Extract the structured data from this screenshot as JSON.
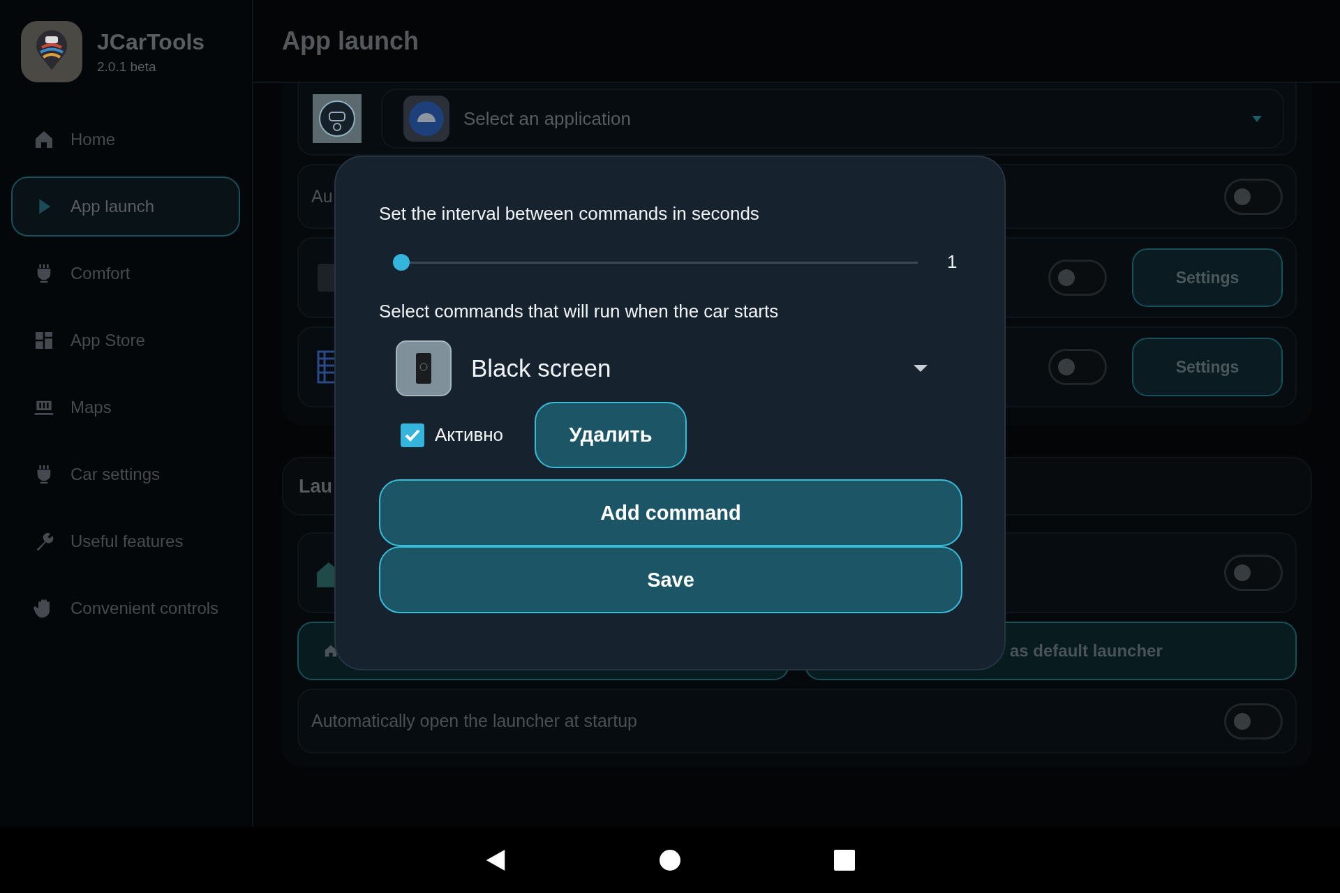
{
  "app": {
    "name": "JCarTools",
    "version": "2.0.1 beta"
  },
  "sidebar": {
    "items": [
      {
        "label": "Home",
        "selected": false
      },
      {
        "label": "App launch",
        "selected": true
      },
      {
        "label": "Comfort",
        "selected": false
      },
      {
        "label": "App Store",
        "selected": false
      },
      {
        "label": "Maps",
        "selected": false
      },
      {
        "label": "Car settings",
        "selected": false
      },
      {
        "label": "Useful features",
        "selected": false
      },
      {
        "label": "Convenient controls",
        "selected": false
      }
    ]
  },
  "header": {
    "title": "App launch"
  },
  "startup_section": {
    "app_select": {
      "placeholder": "Select an application"
    },
    "rows": [
      {
        "kind": "toggle",
        "label": "Au",
        "on": false
      },
      {
        "kind": "settings",
        "on": false,
        "button": "Settings"
      },
      {
        "kind": "settings",
        "on": false,
        "button": "Settings"
      }
    ]
  },
  "launcher_section": {
    "title": "Lau",
    "rows": [
      {
        "kind": "toggle",
        "on": false
      }
    ],
    "buttons": [
      {
        "kind": "icon"
      },
      {
        "kind": "text",
        "label": "as default launcher"
      }
    ],
    "auto_open": {
      "label": "Automatically open the launcher at startup",
      "on": false
    }
  },
  "dialog": {
    "interval_label": "Set the interval between commands in seconds",
    "interval": {
      "level": 0,
      "reading": "1"
    },
    "commands_label": "Select commands that will run when the car starts",
    "command": {
      "value": "Black screen"
    },
    "active": {
      "label": "Активно",
      "checked": true
    },
    "delete_button": "Удалить",
    "add_button": "Add command",
    "save_button": "Save"
  }
}
